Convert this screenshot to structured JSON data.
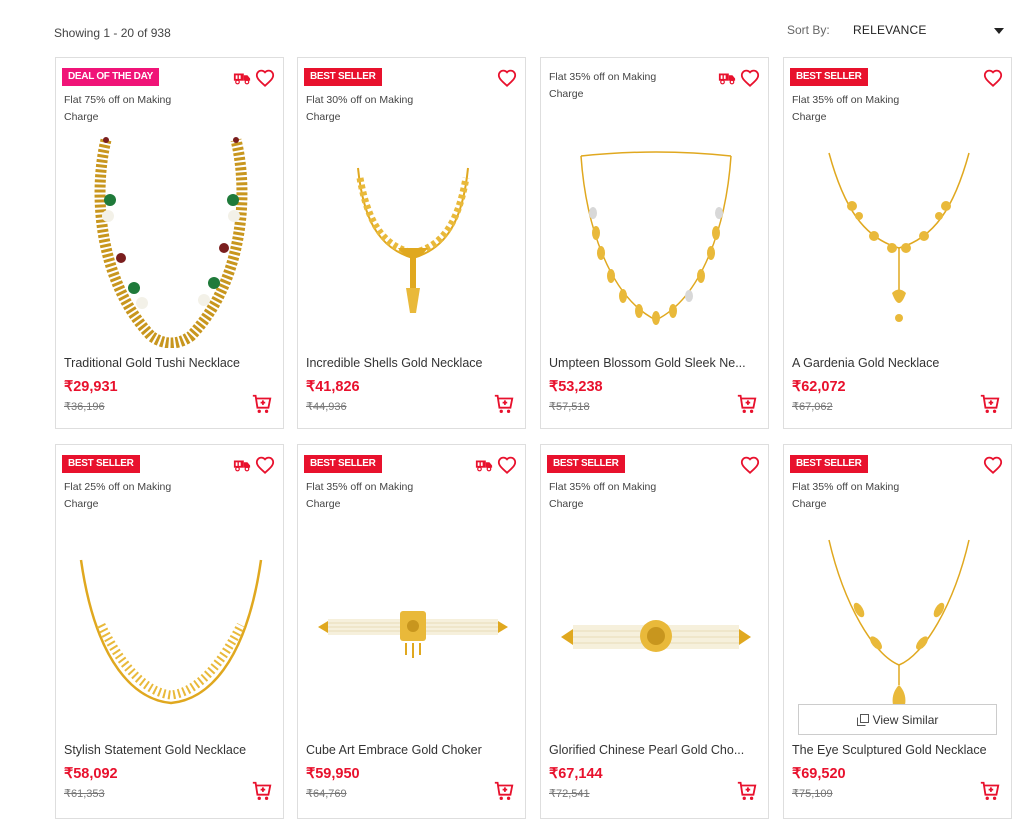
{
  "listing": {
    "showing_text": "Showing 1 - 20 of 938",
    "sort_label": "Sort By:",
    "sort_value": "RELEVANCE"
  },
  "colors": {
    "accent": "#e8112d",
    "deal_badge": "#f01478",
    "gold": "#e0a81f"
  },
  "icons": {
    "wishlist": "heart-icon",
    "delivery": "truck-icon",
    "cart": "add-to-cart-icon",
    "sort": "caret-down-icon",
    "view_similar": "copy-icon"
  },
  "products": [
    {
      "badge": "DEAL OF THE DAY",
      "offer": "Flat 75% off on Making Charge",
      "name": "Traditional Gold Tushi Necklace",
      "price": "₹29,931",
      "mrp": "₹36,196"
    },
    {
      "badge": "BEST SELLER",
      "offer": "Flat 30% off on Making Charge",
      "name": "Incredible Shells Gold Necklace",
      "price": "₹41,826",
      "mrp": "₹44,936"
    },
    {
      "badge": "",
      "offer": "Flat 35% off on Making Charge",
      "name": "Umpteen Blossom Gold Sleek Ne...",
      "price": "₹53,238",
      "mrp": "₹57,518"
    },
    {
      "badge": "BEST SELLER",
      "offer": "Flat 35% off on Making Charge",
      "name": "A Gardenia Gold Necklace",
      "price": "₹62,072",
      "mrp": "₹67,062"
    },
    {
      "badge": "BEST SELLER",
      "offer": "Flat 25% off on Making Charge",
      "name": "Stylish Statement Gold Necklace",
      "price": "₹58,092",
      "mrp": "₹61,353"
    },
    {
      "badge": "BEST SELLER",
      "offer": "Flat 35% off on Making Charge",
      "name": "Cube Art Embrace Gold Choker",
      "price": "₹59,950",
      "mrp": "₹64,769"
    },
    {
      "badge": "BEST SELLER",
      "offer": "Flat 35% off on Making Charge",
      "name": "Glorified Chinese Pearl Gold Cho...",
      "price": "₹67,144",
      "mrp": "₹72,541"
    },
    {
      "badge": "BEST SELLER",
      "offer": "Flat 35% off on Making Charge",
      "name": "The Eye Sculptured Gold Necklace",
      "price": "₹69,520",
      "mrp": "₹75,109",
      "view_similar_label": "View Similar"
    }
  ]
}
